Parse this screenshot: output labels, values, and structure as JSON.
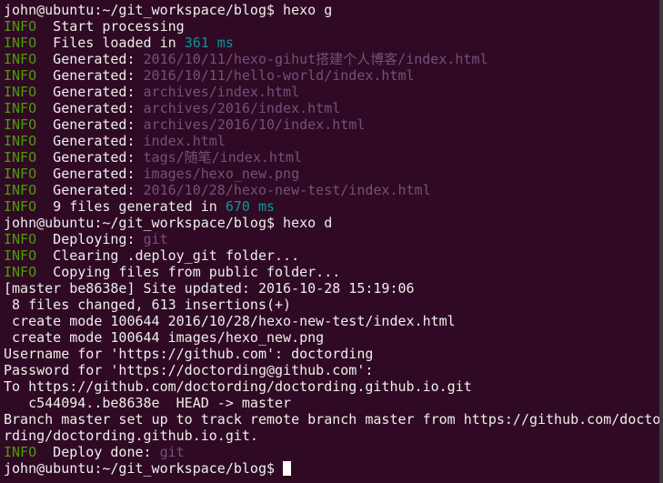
{
  "colors": {
    "background": "#300a24",
    "text": "#eeeeec",
    "info": "#4e9a06",
    "path": "#75507b",
    "number": "#06989a"
  },
  "prompt": "john@ubuntu:~/git_workspace/blog$ ",
  "commands": {
    "cmd1": "hexo g",
    "cmd2": "hexo d"
  },
  "info_tag": "INFO",
  "lines": {
    "start_processing": "  Start processing",
    "files_loaded_prefix": "  Files loaded in ",
    "files_loaded_value": "361 ms",
    "generated_label": "  Generated: ",
    "gen": [
      "2016/10/11/hexo-gihut搭建个人博客/index.html",
      "2016/10/11/hello-world/index.html",
      "archives/index.html",
      "archives/2016/index.html",
      "archives/2016/10/index.html",
      "index.html",
      "tags/随笔/index.html",
      "images/hexo_new.png",
      "2016/10/28/hexo-new-test/index.html"
    ],
    "files_generated_prefix": "  9 files generated in ",
    "files_generated_value": "670 ms",
    "deploying_prefix": "  Deploying: ",
    "deploying_value": "git",
    "clearing": "  Clearing .deploy_git folder...",
    "copying": "  Copying files from public folder...",
    "master_commit": "[master be8638e] Site updated: 2016-10-28 15:19:06",
    "files_changed": " 8 files changed, 613 insertions(+)",
    "create_mode_1": " create mode 100644 2016/10/28/hexo-new-test/index.html",
    "create_mode_2": " create mode 100644 images/hexo_new.png",
    "username": "Username for 'https://github.com': doctording",
    "password": "Password for 'https://doctording@github.com':",
    "to_repo": "To https://github.com/doctording/doctording.github.io.git",
    "head_update": "   c544094..be8638e  HEAD -> master",
    "branch_line_1": "Branch master set up to track remote branch master from https://github.com/docto",
    "branch_line_2": "rding/doctording.github.io.git.",
    "deploy_done_prefix": "  Deploy done: ",
    "deploy_done_value": "git"
  }
}
